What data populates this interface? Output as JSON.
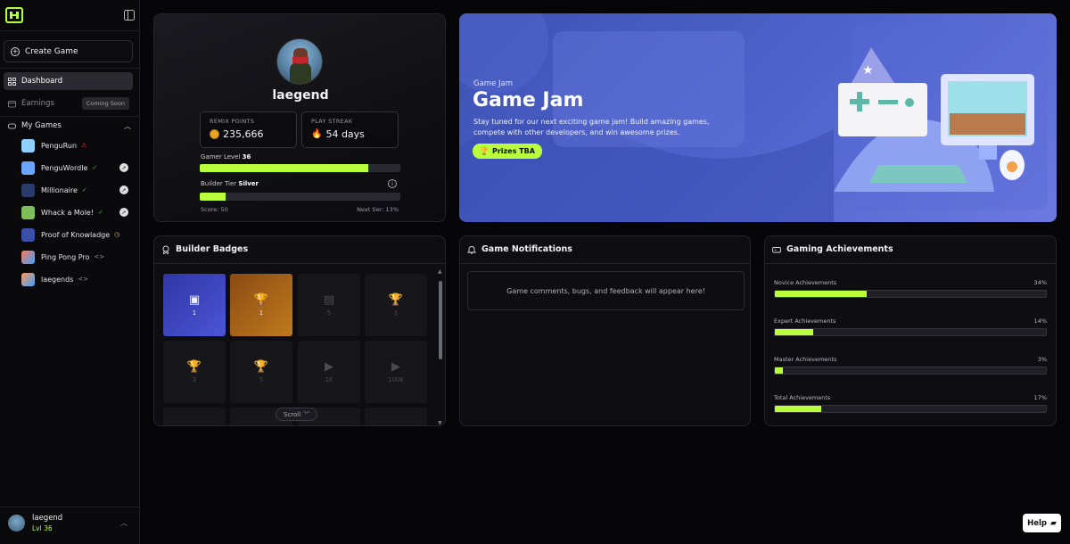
{
  "sidebar": {
    "create_label": "Create Game",
    "nav": [
      {
        "label": "Dashboard",
        "icon": "grid-icon",
        "active": true
      },
      {
        "label": "Earnings",
        "icon": "wallet-icon",
        "badge": "Coming Soon"
      }
    ],
    "my_games_label": "My Games",
    "games": [
      {
        "name": "PenguRun",
        "status": "⚠",
        "status_color": "#e04040",
        "thumb": "#8fd0ff",
        "action": ""
      },
      {
        "name": "PenguWordle",
        "status": "✓",
        "status_color": "#4caf50",
        "thumb": "#6aa6ff",
        "action": "➚"
      },
      {
        "name": "Millionaire",
        "status": "✓",
        "status_color": "#4caf50",
        "thumb": "#2c3c6a",
        "action": "➚"
      },
      {
        "name": "Whack a Mole!",
        "status": "✓",
        "status_color": "#4caf50",
        "thumb": "#7fbf5a",
        "action": "➚"
      },
      {
        "name": "Proof of Knowladge",
        "status": "◷",
        "status_color": "#e6b422",
        "thumb": "#3b4fa8",
        "action": ""
      },
      {
        "name": "Ping Pong Pro",
        "status": "<>",
        "status_color": "#9a9aa2",
        "thumb": "#ff7a59",
        "action": ""
      },
      {
        "name": "laegends",
        "status": "<>",
        "status_color": "#9a9aa2",
        "thumb": "#ff9a5a",
        "action": ""
      }
    ],
    "user": {
      "name": "laegend",
      "level": "Lvl 36"
    }
  },
  "profile": {
    "name": "laegend",
    "remix_label": "REMIX POINTS",
    "remix_value": "235,666",
    "streak_label": "PLAY STREAK",
    "streak_value": "54 days",
    "gamer_level_label": "Gamer Level",
    "gamer_level_value": "36",
    "gamer_level_progress": 0.84,
    "builder_tier_label": "Builder Tier",
    "builder_tier_value": "Silver",
    "builder_tier_progress": 0.13,
    "score": "Score: 50",
    "next_tier": "Next tier: 13%"
  },
  "game_jam": {
    "kicker": "Game Jam",
    "title": "Game Jam",
    "description": "Stay tuned for our next exciting game jam! Build amazing games, compete with other developers, and win awesome prizes.",
    "prize_label": "Prizes TBA"
  },
  "badges": {
    "title": "Builder Badges",
    "items": [
      {
        "glyph": "▣",
        "count": "1",
        "style": "b1"
      },
      {
        "glyph": "🏆",
        "count": "1",
        "style": "b2"
      },
      {
        "glyph": "▤",
        "count": "5",
        "style": ""
      },
      {
        "glyph": "🏆",
        "count": "1",
        "style": ""
      },
      {
        "glyph": "🏆",
        "count": "3",
        "style": ""
      },
      {
        "glyph": "🏆",
        "count": "5",
        "style": ""
      },
      {
        "glyph": "▶",
        "count": "1K",
        "style": ""
      },
      {
        "glyph": "▶",
        "count": "100K",
        "style": ""
      }
    ],
    "scroll_label": "Scroll"
  },
  "notifications": {
    "title": "Game Notifications",
    "empty_text": "Game comments, bugs, and feedback will appear here!"
  },
  "achievements": {
    "title": "Gaming Achievements",
    "items": [
      {
        "label": "Novice Achievements",
        "pct": "34%",
        "value": 0.34
      },
      {
        "label": "Expert Achievements",
        "pct": "14%",
        "value": 0.14
      },
      {
        "label": "Master Achievements",
        "pct": "3%",
        "value": 0.03
      },
      {
        "label": "Total Achievements",
        "pct": "17%",
        "value": 0.17
      }
    ]
  },
  "help_label": "Help",
  "colors": {
    "accent": "#b9ff3c",
    "jam_blue": "#4e63cc"
  }
}
